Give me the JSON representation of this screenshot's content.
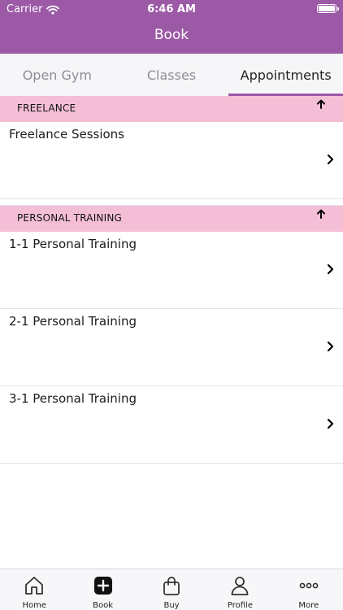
{
  "status_bar": {
    "carrier": "Carrier",
    "time": "6:46 AM"
  },
  "nav": {
    "title": "Book"
  },
  "tabs": [
    {
      "label": "Open Gym"
    },
    {
      "label": "Classes"
    },
    {
      "label": "Appointments"
    }
  ],
  "sections": [
    {
      "title": "FREELANCE",
      "items": [
        {
          "label": "Freelance Sessions"
        }
      ]
    },
    {
      "title": "PERSONAL TRAINING",
      "items": [
        {
          "label": "1-1 Personal Training"
        },
        {
          "label": "2-1 Personal Training"
        },
        {
          "label": "3-1 Personal Training"
        }
      ]
    }
  ],
  "tabbar": [
    {
      "label": "Home",
      "icon": "home-icon"
    },
    {
      "label": "Book",
      "icon": "plus-square-icon"
    },
    {
      "label": "Buy",
      "icon": "shopping-bag-icon"
    },
    {
      "label": "Profile",
      "icon": "person-icon"
    },
    {
      "label": "More",
      "icon": "ellipsis-icon"
    }
  ],
  "colors": {
    "primary": "#9b59a6",
    "section_header": "#f4bfd6"
  }
}
